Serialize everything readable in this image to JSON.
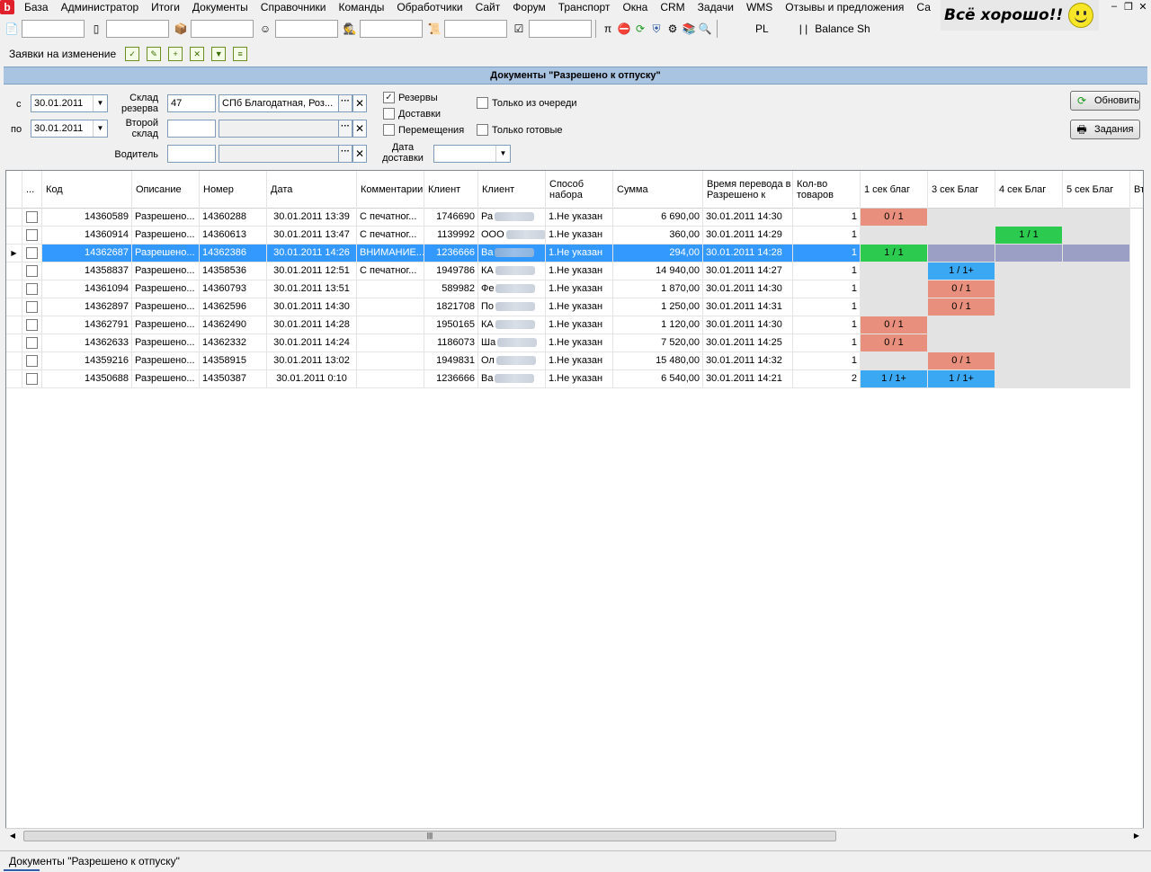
{
  "menu": {
    "items": [
      "База",
      "Администратор",
      "Итоги",
      "Документы",
      "Справочники",
      "Команды",
      "Обработчики",
      "Сайт",
      "Форум",
      "Транспорт",
      "Окна",
      "CRM",
      "Задачи",
      "WMS",
      "Отзывы и предложения",
      "Са"
    ],
    "app_logo": "b"
  },
  "status_badge": {
    "text": "Всё хорошо!!"
  },
  "toolbar": {
    "pl_label": "PL",
    "sep_label": "| |",
    "balance_label": "Balance Sh"
  },
  "toolbar2": {
    "label": "Заявки на изменение"
  },
  "doc_title": "Документы \"Разрешено к отпуску\"",
  "filters": {
    "from_label": "с",
    "from_date": "30.01.2011",
    "to_label": "по",
    "to_date": "30.01.2011",
    "warehouse_label": "Склад резерва",
    "warehouse_code": "47",
    "warehouse_name": "СПб Благодатная, Роз...",
    "second_warehouse_label": "Второй склад",
    "driver_label": "Водитель",
    "delivery_date_label": "Дата доставки",
    "chk_reserves": "Резервы",
    "chk_reserves_checked": true,
    "chk_deliveries": "Доставки",
    "chk_moves": "Перемещения",
    "chk_queue_only": "Только из очереди",
    "chk_ready_only": "Только готовые",
    "btn_refresh": "Обновить",
    "btn_tasks": "Задания"
  },
  "grid": {
    "columns": [
      "...",
      "Код",
      "Описание",
      "Номер",
      "Дата",
      "Комментарии",
      "Клиент",
      "Клиент",
      "Способ набора",
      "Сумма",
      "Время перевода в Разрешено к",
      "Кол-во товаров",
      "1 сек благ",
      "3 сек Благ",
      "4 сек Благ",
      "5 сек Благ",
      "Вт"
    ],
    "rows": [
      {
        "code": "14360589",
        "desc": "Разрешено...",
        "num": "14360288",
        "date": "30.01.2011 13:39",
        "comment": "С печатног...",
        "client_id": "1746690",
        "client": "Ра",
        "method": "1.Не указан",
        "sum": "6 690,00",
        "time": "30.01.2011 14:30",
        "qty": "1",
        "s1": "0 / 1",
        "s1c": "red",
        "s3": "",
        "s3c": "gray",
        "s4": "",
        "s4c": "gray",
        "s5": "",
        "s5c": "gray"
      },
      {
        "code": "14360914",
        "desc": "Разрешено...",
        "num": "14360613",
        "date": "30.01.2011 13:47",
        "comment": "С печатног...",
        "client_id": "1139992",
        "client": "ООО",
        "method": "1.Не указан",
        "sum": "360,00",
        "time": "30.01.2011 14:29",
        "qty": "1",
        "s1": "",
        "s1c": "gray",
        "s3": "",
        "s3c": "gray",
        "s4": "1 / 1",
        "s4c": "green",
        "s5": "",
        "s5c": "gray"
      },
      {
        "code": "14362687",
        "desc": "Разрешено...",
        "num": "14362386",
        "date": "30.01.2011 14:26",
        "comment": "ВНИМАНИЕ...",
        "client_id": "1236666",
        "client": "Ва",
        "method": "1.Не указан",
        "sum": "294,00",
        "time": "30.01.2011 14:28",
        "qty": "1",
        "s1": "1 / 1",
        "s1c": "green",
        "s3": "",
        "s3c": "graysel",
        "s4": "",
        "s4c": "graysel",
        "s5": "",
        "s5c": "graysel",
        "selected": true
      },
      {
        "code": "14358837",
        "desc": "Разрешено...",
        "num": "14358536",
        "date": "30.01.2011 12:51",
        "comment": "С печатног...",
        "client_id": "1949786",
        "client": "КА",
        "method": "1.Не указан",
        "sum": "14 940,00",
        "time": "30.01.2011 14:27",
        "qty": "1",
        "s1": "",
        "s1c": "gray",
        "s3": "1 / 1+",
        "s3c": "blue",
        "s4": "",
        "s4c": "gray",
        "s5": "",
        "s5c": "gray"
      },
      {
        "code": "14361094",
        "desc": "Разрешено...",
        "num": "14360793",
        "date": "30.01.2011 13:51",
        "comment": "",
        "client_id": "589982",
        "client": "Фе",
        "method": "1.Не указан",
        "sum": "1 870,00",
        "time": "30.01.2011 14:30",
        "qty": "1",
        "s1": "",
        "s1c": "gray",
        "s3": "0 / 1",
        "s3c": "red",
        "s4": "",
        "s4c": "gray",
        "s5": "",
        "s5c": "gray"
      },
      {
        "code": "14362897",
        "desc": "Разрешено...",
        "num": "14362596",
        "date": "30.01.2011 14:30",
        "comment": "",
        "client_id": "1821708",
        "client": "По",
        "method": "1.Не указан",
        "sum": "1 250,00",
        "time": "30.01.2011 14:31",
        "qty": "1",
        "s1": "",
        "s1c": "gray",
        "s3": "0 / 1",
        "s3c": "red",
        "s4": "",
        "s4c": "gray",
        "s5": "",
        "s5c": "gray"
      },
      {
        "code": "14362791",
        "desc": "Разрешено...",
        "num": "14362490",
        "date": "30.01.2011 14:28",
        "comment": "",
        "client_id": "1950165",
        "client": "КА",
        "method": "1.Не указан",
        "sum": "1 120,00",
        "time": "30.01.2011 14:30",
        "qty": "1",
        "s1": "0 / 1",
        "s1c": "red",
        "s3": "",
        "s3c": "gray",
        "s4": "",
        "s4c": "gray",
        "s5": "",
        "s5c": "gray"
      },
      {
        "code": "14362633",
        "desc": "Разрешено...",
        "num": "14362332",
        "date": "30.01.2011 14:24",
        "comment": "",
        "client_id": "1186073",
        "client": "Ша",
        "method": "1.Не указан",
        "sum": "7 520,00",
        "time": "30.01.2011 14:25",
        "qty": "1",
        "s1": "0 / 1",
        "s1c": "red",
        "s3": "",
        "s3c": "gray",
        "s4": "",
        "s4c": "gray",
        "s5": "",
        "s5c": "gray"
      },
      {
        "code": "14359216",
        "desc": "Разрешено...",
        "num": "14358915",
        "date": "30.01.2011 13:02",
        "comment": "",
        "client_id": "1949831",
        "client": "Ол",
        "method": "1.Не указан",
        "sum": "15 480,00",
        "time": "30.01.2011 14:32",
        "qty": "1",
        "s1": "",
        "s1c": "gray",
        "s3": "0 / 1",
        "s3c": "red",
        "s4": "",
        "s4c": "gray",
        "s5": "",
        "s5c": "gray"
      },
      {
        "code": "14350688",
        "desc": "Разрешено...",
        "num": "14350387",
        "date": "30.01.2011 0:10",
        "comment": "",
        "client_id": "1236666",
        "client": "Ва",
        "method": "1.Не указан",
        "sum": "6 540,00",
        "time": "30.01.2011 14:21",
        "qty": "2",
        "s1": "1 / 1+",
        "s1c": "blue",
        "s3": "1 / 1+",
        "s3c": "blue",
        "s4": "",
        "s4c": "gray",
        "s5": "",
        "s5c": "gray"
      }
    ]
  },
  "statusbar": {
    "text": "Документы \"Разрешено к отпуску\""
  },
  "colors": {
    "header_blue": "#a9c4e0",
    "selection": "#3399ff",
    "stock_red": "#e8907d",
    "stock_green": "#2cca4e",
    "stock_blue": "#3aa8f2"
  }
}
